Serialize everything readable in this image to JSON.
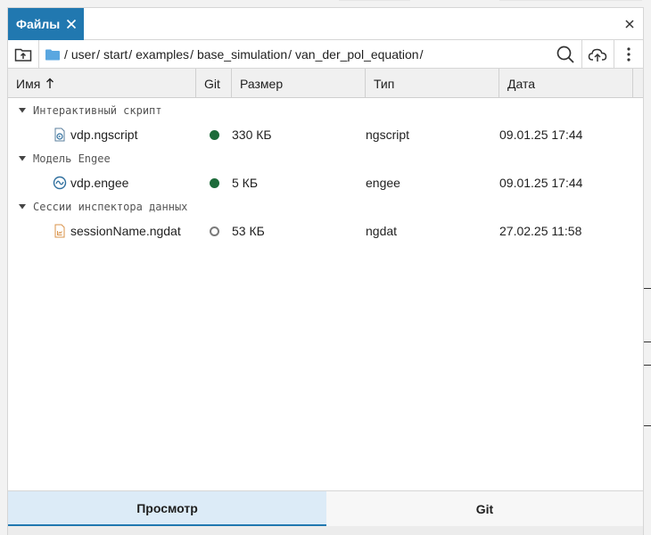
{
  "panel": {
    "tab_label": "Файлы",
    "tab_close_icon": "close-icon",
    "close_icon": "close-icon"
  },
  "toolbar": {
    "upload_folder_icon": "folder-up-icon",
    "search_icon": "search-icon",
    "cloud_upload_icon": "cloud-upload-icon",
    "more_icon": "more-vertical-icon",
    "path": [
      "user",
      "start",
      "examples",
      "base_simulation",
      "van_der_pol_equation"
    ]
  },
  "columns": {
    "name": "Имя",
    "git": "Git",
    "size": "Размер",
    "type": "Тип",
    "date": "Дата"
  },
  "groups": [
    {
      "label": "Интерактивный скрипт",
      "files": [
        {
          "name": "vdp.ngscript",
          "icon": "ngscript-file-icon",
          "git": "committed",
          "size": "330 КБ",
          "type": "ngscript",
          "date": "09.01.25 17:44"
        }
      ]
    },
    {
      "label": "Модель Engee",
      "files": [
        {
          "name": "vdp.engee",
          "icon": "engee-model-icon",
          "git": "committed",
          "size": "5 КБ",
          "type": "engee",
          "date": "09.01.25 17:44"
        }
      ]
    },
    {
      "label": "Сессии инспектора данных",
      "files": [
        {
          "name": "sessionName.ngdat",
          "icon": "ngdat-file-icon",
          "git": "untracked",
          "size": "53 КБ",
          "type": "ngdat",
          "date": "27.02.25 11:58"
        }
      ]
    }
  ],
  "bottom_tabs": [
    {
      "label": "Просмотр",
      "active": true
    },
    {
      "label": "Git",
      "active": false
    }
  ],
  "colors": {
    "accent": "#2178b0",
    "git_committed": "#1d6b3a",
    "git_untracked": "#7a7a7a"
  }
}
